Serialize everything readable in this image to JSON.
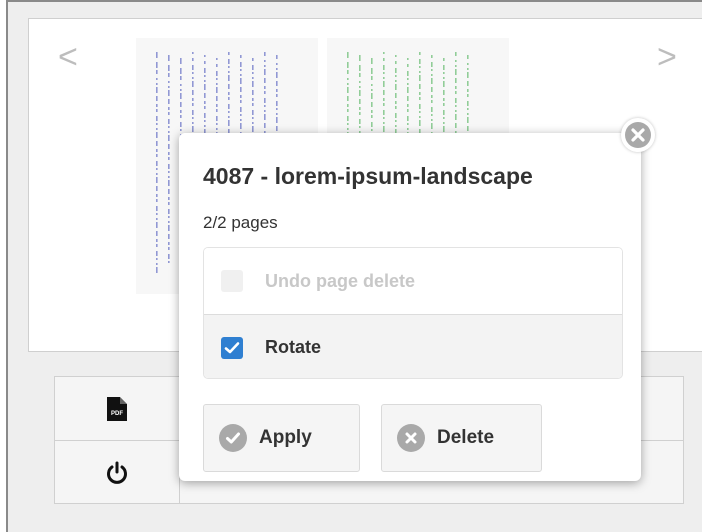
{
  "viewer": {
    "prev_icon": "chevron-left-icon",
    "next_icon": "chevron-right-icon",
    "prev_glyph": "<",
    "next_glyph": ">"
  },
  "toolbar": {
    "pdf_icon": "pdf-icon",
    "pdf_label": "PDF",
    "power_icon": "power-icon"
  },
  "popup": {
    "title": "4087 - lorem-ipsum-landscape",
    "pages": "2/2 pages",
    "close_icon": "close-icon",
    "options": {
      "undo_label": "Undo page delete",
      "undo_enabled": false,
      "rotate_label": "Rotate",
      "rotate_checked": true
    },
    "actions": {
      "apply_label": "Apply",
      "apply_icon": "check-circle-icon",
      "delete_label": "Delete",
      "delete_icon": "close-circle-icon"
    }
  },
  "colors": {
    "accent_checkbox": "#2f7fd1",
    "thumb1_text": "#6f78c8",
    "thumb2_text": "#6fbf78",
    "button_icon_gray": "#a9a9a9"
  }
}
